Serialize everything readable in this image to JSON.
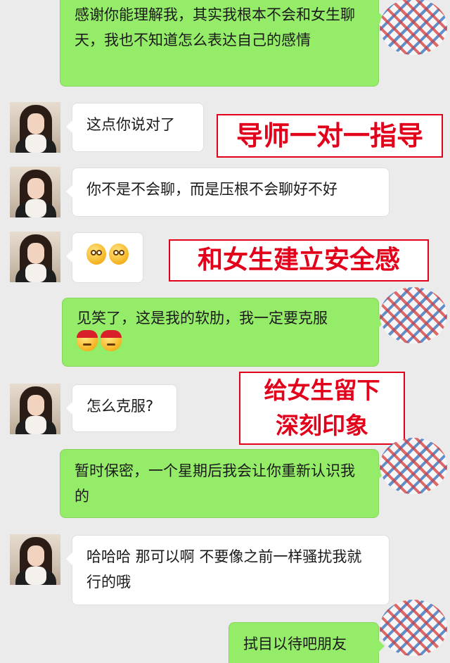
{
  "messages": [
    {
      "sender": "self",
      "text": "感谢你能理解我，其实我根本不会和女生聊天，我也不知道怎么表达自己的感情"
    },
    {
      "sender": "other",
      "text": "这点你说对了"
    },
    {
      "sender": "other",
      "text": "你不是不会聊，而是压根不会聊好不好"
    },
    {
      "sender": "other",
      "emojis": [
        "smile-emoji",
        "smile-emoji"
      ]
    },
    {
      "sender": "self",
      "text": "见笑了，这是我的软肋，我一定要克服",
      "emojis": [
        "angry-emoji",
        "angry-emoji"
      ]
    },
    {
      "sender": "other",
      "text": "怎么克服?"
    },
    {
      "sender": "self",
      "text": "暂时保密，一个星期后我会让你重新认识我的"
    },
    {
      "sender": "other",
      "text": "哈哈哈 那可以啊 不要像之前一样骚扰我就行的哦"
    },
    {
      "sender": "self",
      "text": "拭目以待吧朋友"
    }
  ],
  "overlays": [
    {
      "text": "导师一对一指导"
    },
    {
      "text": "和女生建立安全感"
    },
    {
      "lines": [
        "给女生留下",
        "深刻印象"
      ]
    }
  ],
  "colors": {
    "background": "#ebebeb",
    "sent_bubble": "#95ec69",
    "received_bubble": "#ffffff",
    "overlay_text": "#e3001b"
  }
}
